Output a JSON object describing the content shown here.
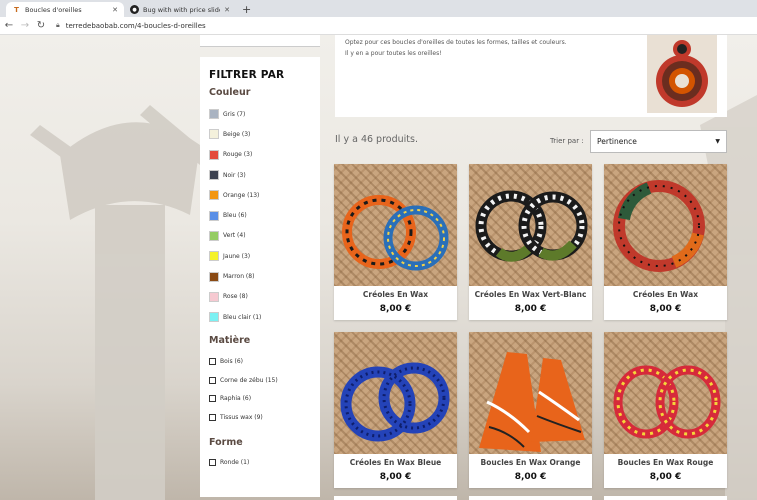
{
  "browser": {
    "tabs": [
      {
        "title": "Boucles d'oreilles",
        "active": true,
        "icon": "terredebaobab-favicon"
      },
      {
        "title": "Bug with with price slider and se",
        "active": false,
        "icon": "github-icon"
      }
    ],
    "new_tab_label": "+",
    "url": "terredebaobab.com/4-boucles-d-oreilles"
  },
  "sidebar": {
    "title": "FILTRER PAR",
    "couleur": {
      "title": "Couleur",
      "items": [
        {
          "label": "Gris (7)",
          "color": "#a9b3c1"
        },
        {
          "label": "Beige (3)",
          "color": "#f4f1dc"
        },
        {
          "label": "Rouge (3)",
          "color": "#e34b3c"
        },
        {
          "label": "Noir (3)",
          "color": "#3d4250"
        },
        {
          "label": "Orange (13)",
          "color": "#f29612"
        },
        {
          "label": "Bleu (6)",
          "color": "#5a8fe6"
        },
        {
          "label": "Vert (4)",
          "color": "#95cc63"
        },
        {
          "label": "Jaune (3)",
          "color": "#f4f22a"
        },
        {
          "label": "Marron (8)",
          "color": "#8a4a14"
        },
        {
          "label": "Rose (8)",
          "color": "#f6c9d1"
        },
        {
          "label": "Bleu clair (1)",
          "color": "#7cf1f3"
        }
      ]
    },
    "matiere": {
      "title": "Matière",
      "items": [
        {
          "label": "Bois (6)"
        },
        {
          "label": "Corne de zébu (15)"
        },
        {
          "label": "Raphia (6)"
        },
        {
          "label": "Tissus wax (9)"
        }
      ]
    },
    "forme": {
      "title": "Forme",
      "items": [
        {
          "label": "Ronde (1)"
        }
      ]
    }
  },
  "category": {
    "desc_line1": "Optez pour ces boucles d'oreilles de toutes les formes, tailles et couleurs.",
    "desc_line2": "Il y en a pour toutes les oreilles!"
  },
  "listing": {
    "count_text": "Il y a 46 produits.",
    "sort_label": "Trier par :",
    "sort_value": "Pertinence"
  },
  "products": [
    {
      "name": "Créoles En Wax",
      "price": "8,00 €"
    },
    {
      "name": "Créoles En Wax Vert-Blanc",
      "price": "8,00 €"
    },
    {
      "name": "Créoles En Wax",
      "price": "8,00 €"
    },
    {
      "name": "Créoles En Wax Bleue",
      "price": "8,00 €"
    },
    {
      "name": "Boucles En Wax Orange",
      "price": "8,00 €"
    },
    {
      "name": "Boucles En Wax Rouge",
      "price": "8,00 €"
    }
  ]
}
